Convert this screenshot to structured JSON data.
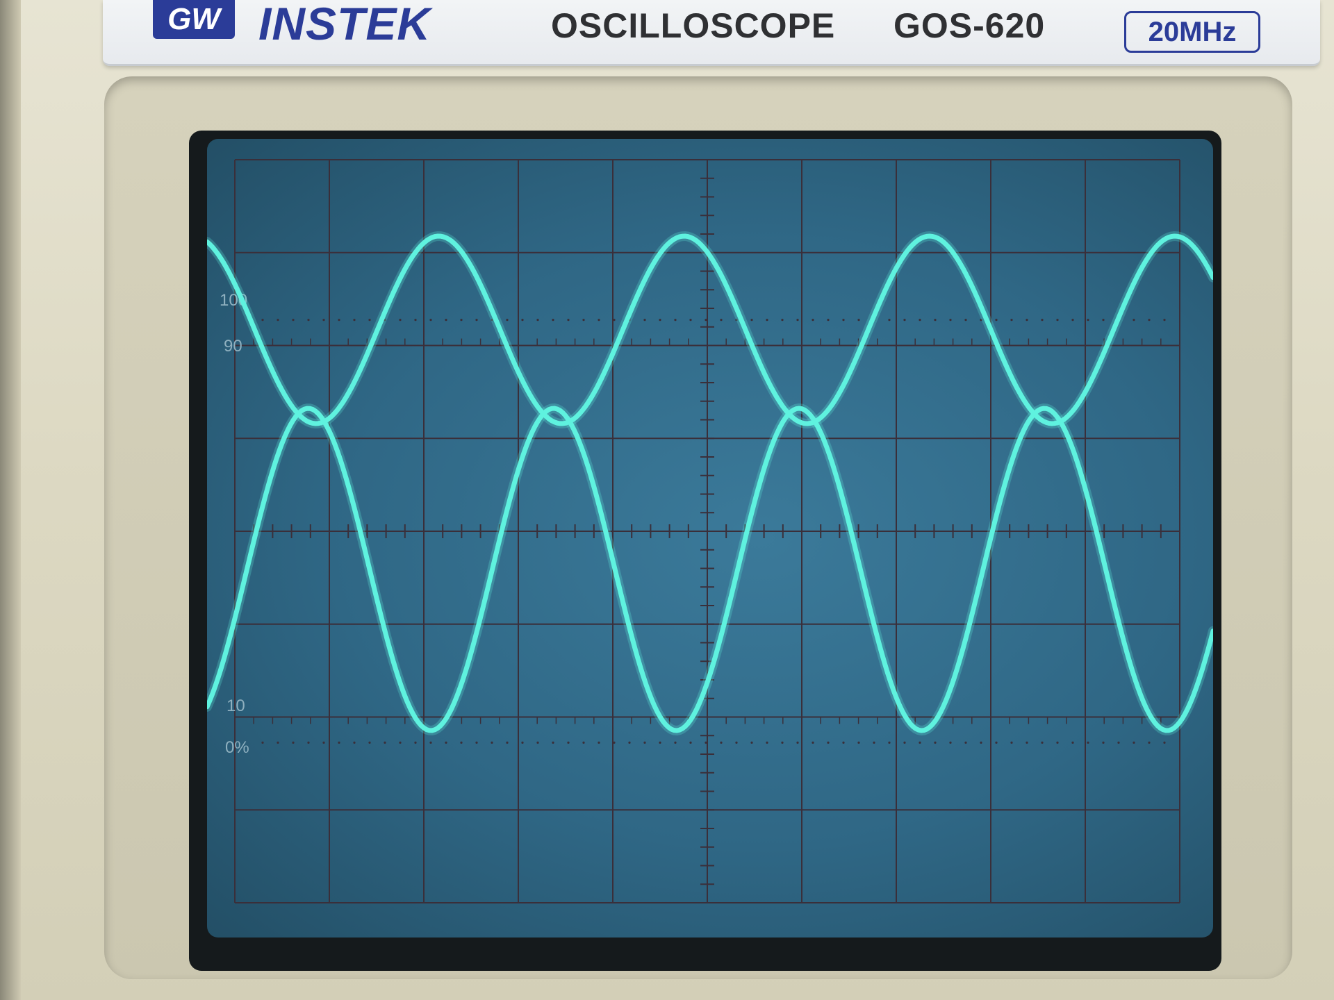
{
  "header": {
    "brand_logo": "GW",
    "brand_name": "INSTEK",
    "device_type": "OSCILLOSCOPE",
    "model": "GOS-620",
    "bandwidth": "20MHz"
  },
  "graticule": {
    "label_100": "100",
    "label_90": "90",
    "label_10": "10",
    "label_0": "0%"
  },
  "traces": {
    "color": "#5ff2df",
    "channel_1": {
      "cycles_visible": 4.1
    },
    "channel_2": {
      "cycles_visible": 4.1
    }
  },
  "colors": {
    "bezel": "#ddd9c3",
    "brand_blue": "#2b3c98",
    "screen": "#2f6785",
    "grid": "#3a2f3a"
  }
}
